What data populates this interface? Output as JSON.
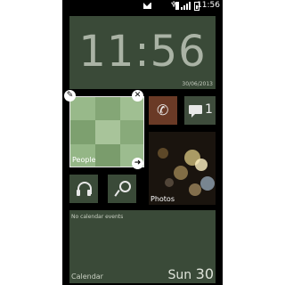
{
  "status_bar": {
    "time": "11:56",
    "icons": [
      "mail-icon",
      "gps-icon",
      "wifi-icon",
      "signal-icon",
      "battery-icon"
    ]
  },
  "clock_tile": {
    "time": "11:56",
    "date": "30/06/2013"
  },
  "people_tile": {
    "label": "People",
    "edit_icons": [
      "wrench-icon",
      "close-icon",
      "arrow-right-icon"
    ],
    "colors": [
      "#a8c49a",
      "#7ea271",
      "#94b686",
      "#6f9562"
    ]
  },
  "phone_tile": {
    "icon": "phone-icon",
    "color": "#6a3a26"
  },
  "messaging_tile": {
    "icon": "message-icon",
    "count": "1"
  },
  "photos_tile": {
    "label": "Photos"
  },
  "music_tile": {
    "icon": "headphones-icon"
  },
  "search_tile": {
    "icon": "search-icon"
  },
  "calendar_tile": {
    "events_text": "No calendar events",
    "label": "Calendar",
    "day_name": "Sun",
    "day_number": "30"
  },
  "colors": {
    "tile": "#3a4a38",
    "background": "#000000",
    "accent_text": "#ffffff"
  }
}
